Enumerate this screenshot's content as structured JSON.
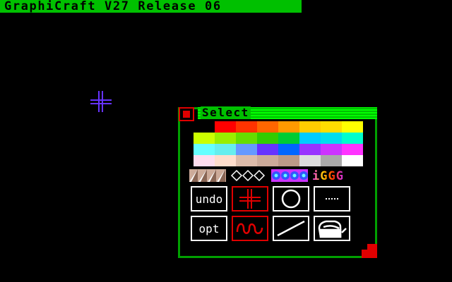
{
  "app": {
    "title": "GraphiCraft V27 Release 06"
  },
  "panel": {
    "title": "Select",
    "palette": {
      "rows": [
        [
          "#000000",
          "#ff0000",
          "#ff3300",
          "#ff6600",
          "#ff9900",
          "#ffcc00",
          "#ffdd00",
          "#ffff00"
        ],
        [
          "#ccff00",
          "#99ee00",
          "#66dd00",
          "#33cc00",
          "#00cc33",
          "#00ccff",
          "#00ddee",
          "#00ffcc"
        ],
        [
          "#66ffff",
          "#66eeee",
          "#6699ff",
          "#6633ff",
          "#0066ff",
          "#9933ff",
          "#cc33ff",
          "#ff33ff"
        ],
        [
          "#ffddee",
          "#ffddcc",
          "#ddbbaa",
          "#ccaa99",
          "#bb9988",
          "#dddddd",
          "#aaaaaa",
          "#ffffff"
        ]
      ]
    },
    "patterns": [
      {
        "name": "brick-pattern"
      },
      {
        "name": "diamond-outline-pattern"
      },
      {
        "name": "blue-dots-pattern"
      },
      {
        "name": "rainbow-text-pattern",
        "text": "iGGG"
      }
    ],
    "tools": [
      {
        "name": "undo-button",
        "label": "undo",
        "selected": false
      },
      {
        "name": "crosshair-tool",
        "icon": "crosshair-icon",
        "selected": true
      },
      {
        "name": "circle-tool",
        "icon": "circle-icon",
        "selected": false
      },
      {
        "name": "dots-tool",
        "icon": "dots-icon",
        "selected": false
      },
      {
        "name": "options-button",
        "label": "opt",
        "selected": false
      },
      {
        "name": "freehand-tool",
        "icon": "squiggle-icon",
        "selected": true
      },
      {
        "name": "line-tool",
        "icon": "line-icon",
        "selected": false
      },
      {
        "name": "fill-tool",
        "icon": "paint-bucket-icon",
        "selected": false
      }
    ]
  },
  "colors": {
    "accent": "#00c000",
    "selected": "#e00000",
    "cursor": "#6633ff"
  }
}
